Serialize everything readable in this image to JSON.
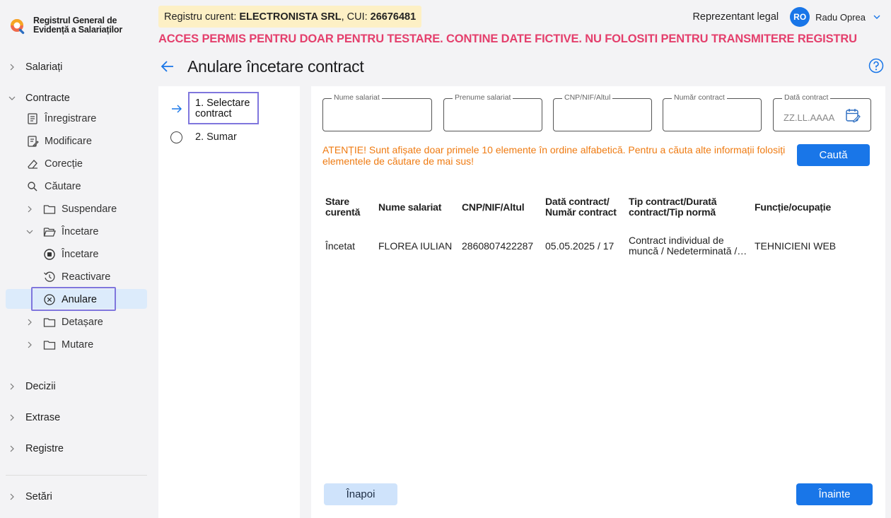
{
  "app": {
    "title_line1": "Registrul General de",
    "title_line2": "Evidență a Salariaților"
  },
  "header": {
    "registry_prefix": "Registru curent:",
    "registry_company": "ELECTRONISTA SRL",
    "registry_cui_prefix": ", CUI:",
    "registry_cui": "26676481",
    "warning": "ACCES PERMIS PENTRU DOAR PENTRU TESTARE. CONTINE DATE FICTIVE. NU FOLOSITI PENTRU TRANSMITERE REGISTRU",
    "user_role": "Reprezentant legal",
    "user_initials": "RO",
    "user_name": "Radu Oprea"
  },
  "sidebar": {
    "salariati": "Salariați",
    "contracte": "Contracte",
    "contracte_items": {
      "inregistrare": "Înregistrare",
      "modificare": "Modificare",
      "corectie": "Corecție",
      "cautare": "Căutare",
      "suspendare": "Suspendare",
      "incetare": "Încetare",
      "incetare_sub": {
        "incetare": "Încetare",
        "reactivare": "Reactivare",
        "anulare": "Anulare"
      },
      "detasare": "Detașare",
      "mutare": "Mutare"
    },
    "decizii": "Decizii",
    "extrase": "Extrase",
    "registre": "Registre",
    "setari": "Setări"
  },
  "page": {
    "title": "Anulare încetare contract"
  },
  "steps": {
    "step1": "1. Selectare contract",
    "step2": "2. Sumar"
  },
  "search": {
    "nume_label": "Nume salariat",
    "prenume_label": "Prenume salariat",
    "cnp_label": "CNP/NIF/Altul",
    "numar_label": "Număr contract",
    "data_label": "Dată contract",
    "data_placeholder": "ZZ.LL.AAAA",
    "notice": "ATENȚIE! Sunt afișate doar primele 10 elemente în ordine alfabetică. Pentru a căuta alte informații folosiți elementele de căutare de mai sus!",
    "button": "Caută"
  },
  "table": {
    "headers": {
      "stare": "Stare curentă",
      "nume": "Nume salariat",
      "cnp": "CNP/NIF/Altul",
      "data": "Dată contract/ Număr contract",
      "tip": "Tip contract/Durată contract/Tip normă",
      "functie": "Funcție/ocupație"
    },
    "rows": [
      {
        "stare": "Încetat",
        "nume": "FLOREA IULIAN",
        "cnp": "2860807422287",
        "data": "05.05.2025 / 17",
        "tip": "Contract individual de muncă / Nedeterminată / Normă întreagă",
        "functie": "TEHNICIENI WEB"
      }
    ]
  },
  "footer": {
    "back": "Înapoi",
    "next": "Înainte"
  },
  "colors": {
    "accent": "#1976e8",
    "warning_banner": "#e43f6c",
    "notice": "#ef7b12",
    "selection_border": "#7f76dd",
    "registry_badge_bg": "#fdf0c5"
  }
}
